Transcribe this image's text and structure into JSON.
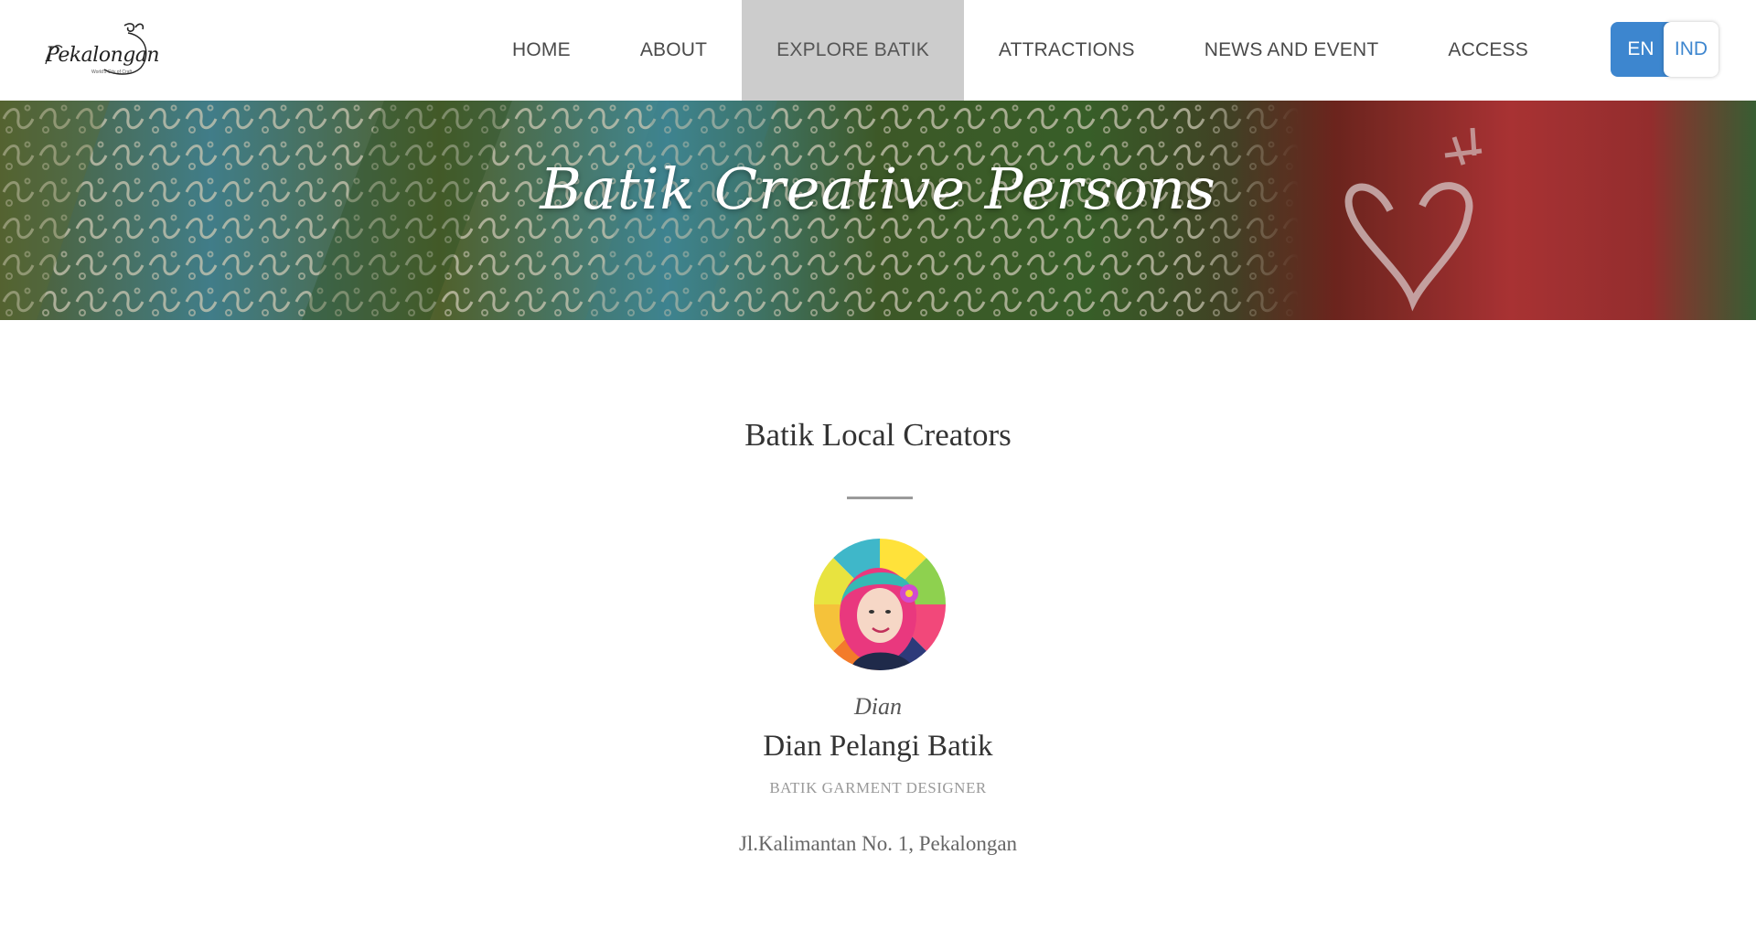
{
  "header": {
    "logo": {
      "text": "Pekalongan",
      "subtext": "World's City of Craft"
    },
    "nav": [
      {
        "label": "HOME",
        "active": false
      },
      {
        "label": "ABOUT",
        "active": false
      },
      {
        "label": "EXPLORE BATIK",
        "active": true
      },
      {
        "label": "ATTRACTIONS",
        "active": false
      },
      {
        "label": "NEWS AND EVENT",
        "active": false
      },
      {
        "label": "ACCESS",
        "active": false
      }
    ],
    "language": {
      "en_label": "EN",
      "ind_label": "IND",
      "selected": "EN"
    }
  },
  "banner": {
    "title": "Batik Creative Persons"
  },
  "main": {
    "section_title": "Batik Local Creators",
    "creator": {
      "short_name": "Dian",
      "name": "Dian Pelangi Batik",
      "role": "BATIK GARMENT DESIGNER",
      "address": "Jl.Kalimantan No. 1, Pekalongan"
    }
  },
  "colors": {
    "accent": "#3d86cf",
    "nav_active_bg": "#cccccc",
    "text_dark": "#333333",
    "text_muted": "#999999"
  }
}
